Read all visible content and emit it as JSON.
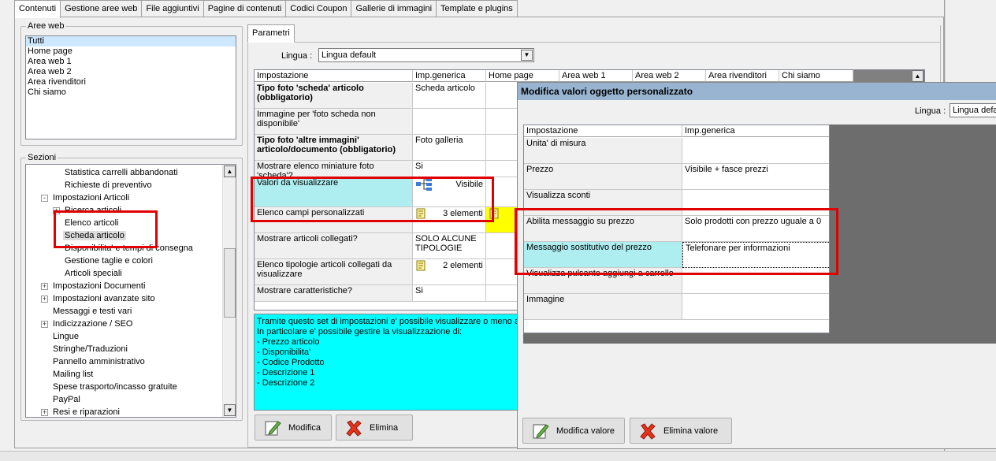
{
  "tabs": [
    "Contenuti",
    "Gestione aree web",
    "File aggiuntivi",
    "Pagine di contenuti",
    "Codici Coupon",
    "Gallerie di immagini",
    "Template e plugins"
  ],
  "aree_web": {
    "title": "Aree web",
    "items": [
      "Tutti",
      "Home page",
      "Area web 1",
      "Area web 2",
      "Area rivenditori",
      "Chi siamo"
    ]
  },
  "sezioni": {
    "title": "Sezioni",
    "items": [
      {
        "label": "Statistica carrelli abbandonati",
        "indent": 2
      },
      {
        "label": "Richieste di preventivo",
        "indent": 2
      },
      {
        "label": "Impostazioni Articoli",
        "indent": 1,
        "expander": "-"
      },
      {
        "label": "Ricerca articoli",
        "indent": 2,
        "expander": "+"
      },
      {
        "label": "Elenco articoli",
        "indent": 2
      },
      {
        "label": "Scheda articolo",
        "indent": 2,
        "selected": true
      },
      {
        "label": "Disponibilita' e tempi di consegna",
        "indent": 2
      },
      {
        "label": "Gestione taglie e colori",
        "indent": 2
      },
      {
        "label": "Articoli speciali",
        "indent": 2
      },
      {
        "label": "Impostazioni Documenti",
        "indent": 1,
        "expander": "+"
      },
      {
        "label": "Impostazioni avanzate sito",
        "indent": 1,
        "expander": "+"
      },
      {
        "label": "Messaggi e testi vari",
        "indent": 1
      },
      {
        "label": "Indicizzazione / SEO",
        "indent": 1,
        "expander": "+"
      },
      {
        "label": "Lingue",
        "indent": 1
      },
      {
        "label": "Stringhe/Traduzioni",
        "indent": 1
      },
      {
        "label": "Pannello amministrativo",
        "indent": 1
      },
      {
        "label": "Mailing list",
        "indent": 1
      },
      {
        "label": "Spese trasporto/incasso gratuite",
        "indent": 1
      },
      {
        "label": "PayPal",
        "indent": 1
      },
      {
        "label": "Resi e riparazioni",
        "indent": 1,
        "expander": "+"
      }
    ]
  },
  "parametri": {
    "tab": "Parametri",
    "lingua_label": "Lingua :",
    "lingua_value": "Lingua default",
    "headers": [
      "Impostazione",
      "Imp.generica",
      "Home page",
      "Area web 1",
      "Area web 2",
      "Area rivenditori",
      "Chi siamo"
    ],
    "rows": [
      {
        "label": "Tipo foto 'scheda' articolo (obbligatorio)",
        "value": "Scheda articolo",
        "bold": true
      },
      {
        "label": "Immagine per 'foto scheda non disponibile'",
        "value": ""
      },
      {
        "label": "Tipo foto 'altre immagini' articolo/documento (obbligatorio)",
        "value": "Foto galleria",
        "bold": true
      },
      {
        "label": "Mostrare elenco miniature foto 'scheda'?",
        "value": "Si"
      },
      {
        "label": "Valori da visualizzare",
        "value": "Visibile",
        "icon": "tree"
      },
      {
        "label": "Elenco campi personalizzati",
        "value": "3 elementi",
        "icon": "note"
      },
      {
        "label": "Mostrare articoli collegati?",
        "value": "SOLO ALCUNE TIPOLOGIE"
      },
      {
        "label": "Elenco tipologie articoli collegati da visualizzare",
        "value": "2 elementi",
        "icon": "note"
      },
      {
        "label": "Mostrare caratteristiche?",
        "value": "Si"
      }
    ],
    "info_text": "Tramite questo set di impostazioni e' possibile visualizzare o meno alcu\nIn particolare e' possibile gestire la visualizzazione di:\n- Prezzo articolo\n- Disponibilita'\n- Codice Prodotto\n- Descrizione 1\n- Descrizione 2",
    "btn_modifica": "Modifica",
    "btn_elimina": "Elimina"
  },
  "dialog": {
    "title": "Modifica valori oggetto personalizzato",
    "lingua_label": "Lingua :",
    "lingua_value": "Lingua defa",
    "headers": [
      "Impostazione",
      "Imp.generica"
    ],
    "rows": [
      {
        "label": "Unita' di misura",
        "value": ""
      },
      {
        "label": "Prezzo",
        "value": "Visibile + fasce prezzi"
      },
      {
        "label": "Visualizza sconti",
        "value": ""
      },
      {
        "label": "Abilita messaggio su prezzo",
        "value": "Solo prodotti con prezzo uguale a 0"
      },
      {
        "label": "Messaggio sostitutivo del prezzo",
        "value": "Telefonare per informazioni"
      },
      {
        "label": "Visualizza pulsante aggiungi a carrello",
        "value": ""
      },
      {
        "label": "Immagine",
        "value": ""
      }
    ],
    "btn_modifica": "Modifica valore",
    "btn_elimina": "Elimina valore"
  },
  "colors": {
    "highlight_red": "#e00000",
    "info_cyan": "#00ffff",
    "selected_cyan": "#aeeef0",
    "dialog_title": "#99b4d1"
  }
}
